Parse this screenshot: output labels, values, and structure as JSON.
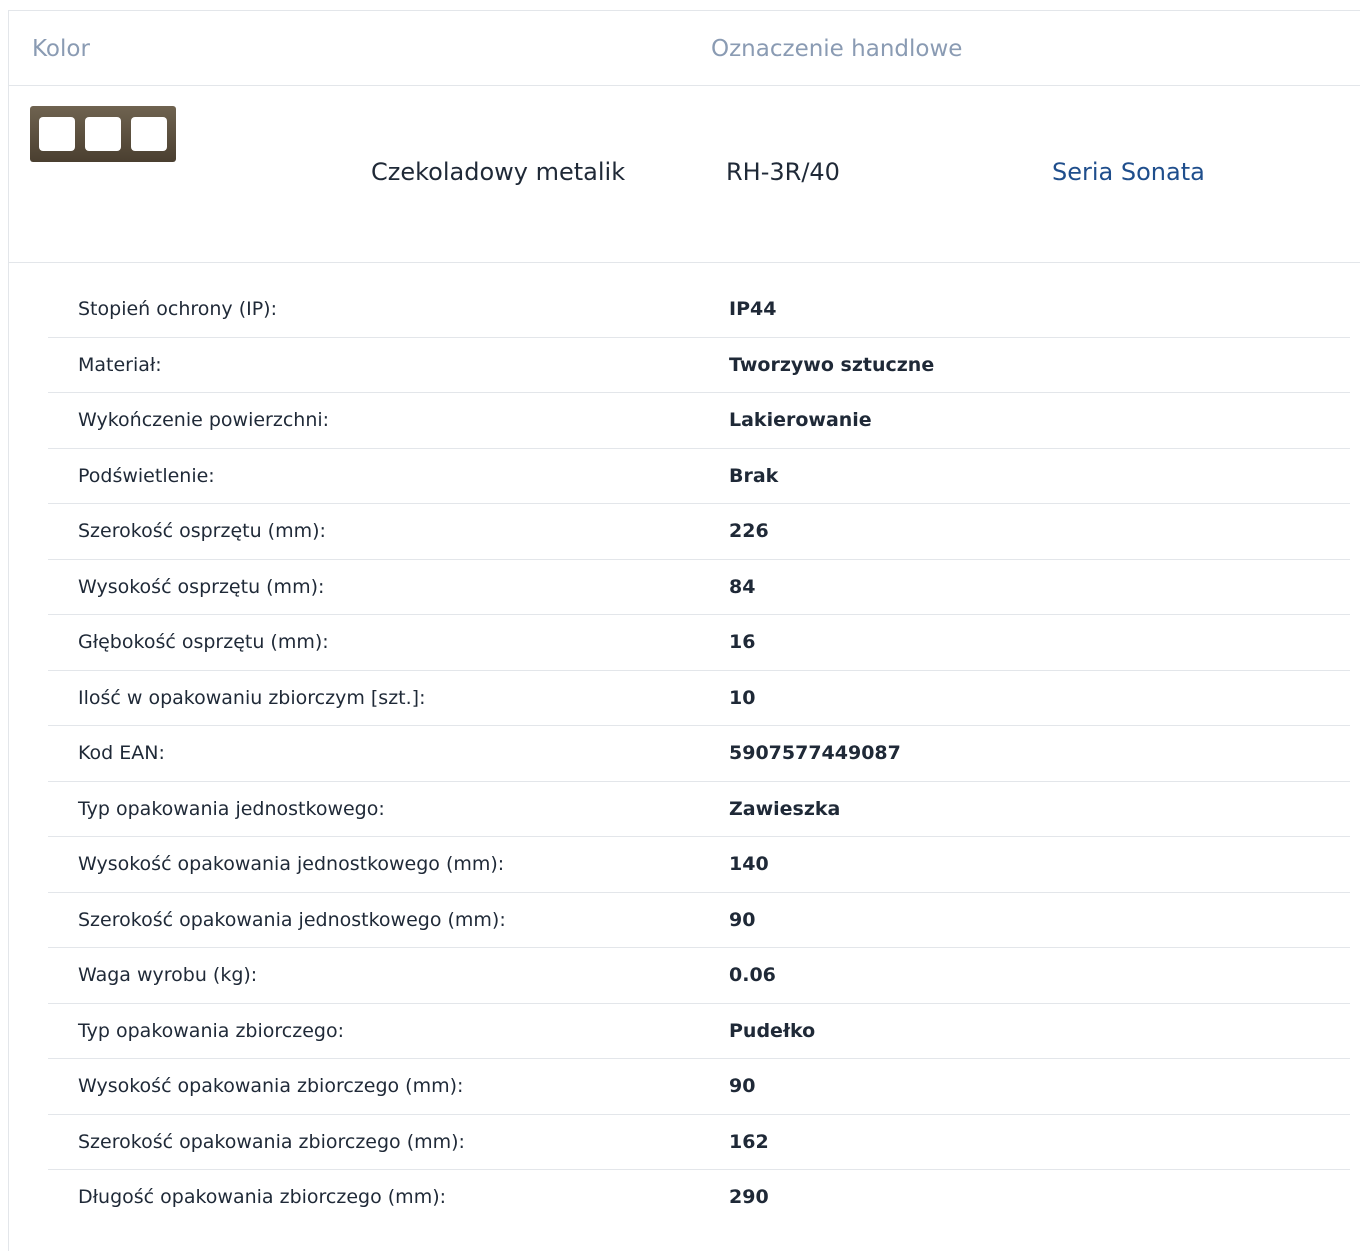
{
  "header": {
    "color_col": "Kolor",
    "trade_col": "Oznaczenie handlowe"
  },
  "product": {
    "thumbnail_icon": "three-gang-frame-icon",
    "thumbnail_color": "#5a4e3e",
    "color_name": "Czekoladowy metalik",
    "trade_name": "RH-3R/40",
    "series_link": "Seria Sonata"
  },
  "specs": [
    {
      "label": "Stopień ochrony (IP):",
      "value": "IP44"
    },
    {
      "label": "Materiał:",
      "value": "Tworzywo sztuczne"
    },
    {
      "label": "Wykończenie powierzchni:",
      "value": "Lakierowanie"
    },
    {
      "label": "Podświetlenie:",
      "value": "Brak"
    },
    {
      "label": "Szerokość osprzętu (mm):",
      "value": "226"
    },
    {
      "label": "Wysokość osprzętu (mm):",
      "value": "84"
    },
    {
      "label": "Głębokość osprzętu (mm):",
      "value": "16"
    },
    {
      "label": "Ilość w opakowaniu zbiorczym [szt.]:",
      "value": "10"
    },
    {
      "label": "Kod EAN:",
      "value": "5907577449087"
    },
    {
      "label": "Typ opakowania jednostkowego:",
      "value": "Zawieszka"
    },
    {
      "label": "Wysokość opakowania jednostkowego (mm):",
      "value": "140"
    },
    {
      "label": "Szerokość opakowania jednostkowego (mm):",
      "value": "90"
    },
    {
      "label": "Waga wyrobu (kg):",
      "value": "0.06"
    },
    {
      "label": "Typ opakowania zbiorczego:",
      "value": "Pudełko"
    },
    {
      "label": "Wysokość opakowania zbiorczego (mm):",
      "value": "90"
    },
    {
      "label": "Szerokość opakowania zbiorczego (mm):",
      "value": "162"
    },
    {
      "label": "Długość opakowania zbiorczego (mm):",
      "value": "290"
    }
  ]
}
